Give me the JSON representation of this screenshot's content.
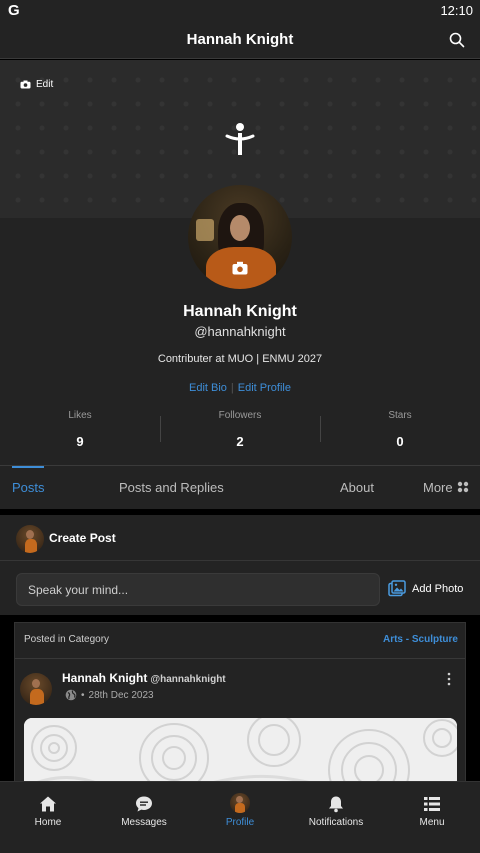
{
  "status_bar": {
    "app_letter": "G",
    "time": "12:10"
  },
  "app_bar": {
    "title": "Hannah Knight"
  },
  "cover": {
    "edit_label": "Edit"
  },
  "profile": {
    "name": "Hannah Knight",
    "handle": "@hannahknight",
    "bio": "Contributer at MUO | ENMU 2027",
    "edit_bio": "Edit Bio",
    "link_separator": "|",
    "edit_profile": "Edit Profile"
  },
  "stats": [
    {
      "label": "Likes",
      "value": "9"
    },
    {
      "label": "Followers",
      "value": "2"
    },
    {
      "label": "Stars",
      "value": "0"
    }
  ],
  "tabs": [
    {
      "label": "Posts",
      "active": true
    },
    {
      "label": "Posts and Replies",
      "active": false
    },
    {
      "label": "About",
      "active": false
    },
    {
      "label": "More",
      "active": false
    }
  ],
  "create_post": {
    "title": "Create Post",
    "placeholder": "Speak your mind...",
    "add_photo": "Add Photo"
  },
  "post": {
    "category_label": "Posted in Category",
    "category": "Arts - Sculpture",
    "author": "Hannah Knight",
    "author_handle": "@hannahknight",
    "date": "28th Dec 2023"
  },
  "bottom_nav": [
    {
      "label": "Home",
      "icon": "home-icon"
    },
    {
      "label": "Messages",
      "icon": "messages-icon"
    },
    {
      "label": "Profile",
      "icon": "avatar-icon",
      "active": true
    },
    {
      "label": "Notifications",
      "icon": "bell-icon"
    },
    {
      "label": "Menu",
      "icon": "menu-list-icon"
    }
  ],
  "colors": {
    "accent": "#3e8ed8",
    "surface": "#232323",
    "background": "#000000"
  }
}
